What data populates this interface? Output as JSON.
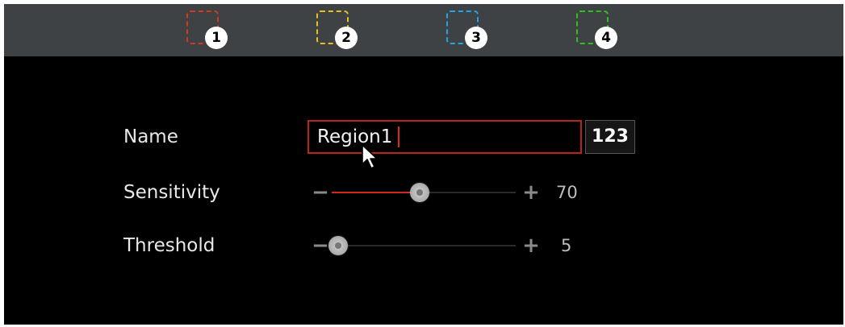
{
  "regions": [
    {
      "number": "1",
      "color": "#d8361f"
    },
    {
      "number": "2",
      "color": "#e6c21a"
    },
    {
      "number": "3",
      "color": "#1ea6e6"
    },
    {
      "number": "4",
      "color": "#2ec21a"
    }
  ],
  "form": {
    "name": {
      "label": "Name",
      "value": "Region1",
      "keyboard_label": "123"
    },
    "sensitivity": {
      "label": "Sensitivity",
      "value": 70,
      "value_text": "70",
      "min": 0,
      "max": 100,
      "minus": "−",
      "plus": "+"
    },
    "threshold": {
      "label": "Threshold",
      "value": 5,
      "value_text": "5",
      "min": 0,
      "max": 100,
      "minus": "−",
      "plus": "+"
    }
  },
  "colors": {
    "accent_red": "#d02a1e",
    "bar_gray": "#3f4245",
    "background": "#000000"
  },
  "icons": {
    "pointer": "mouse-pointer-icon"
  }
}
